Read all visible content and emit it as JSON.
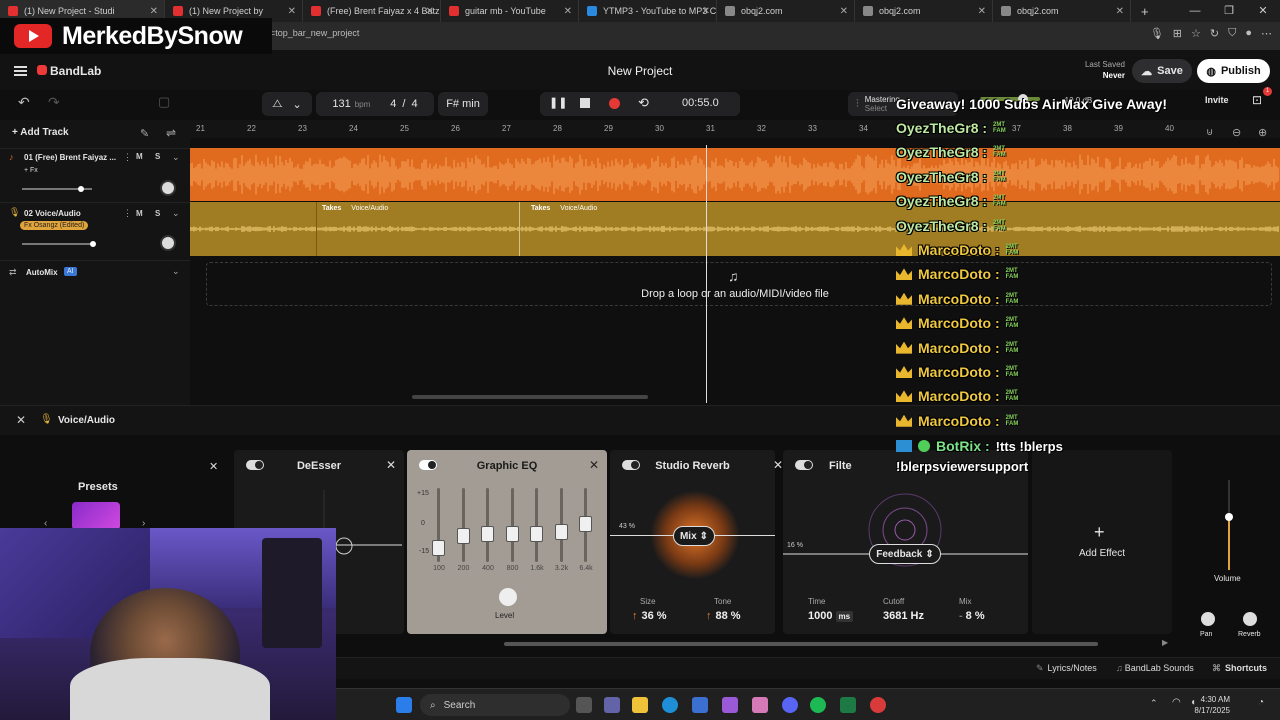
{
  "browser": {
    "tabs": [
      {
        "label": "(1) New Project - Studi",
        "active": true,
        "color": "#e23030"
      },
      {
        "label": "(1) New Project by",
        "active": false,
        "color": "#e23030"
      },
      {
        "label": "(Free) Brent Faiyaz x 4 Batz",
        "active": false,
        "color": "#e23030"
      },
      {
        "label": "guitar mb - YouTube",
        "active": false,
        "color": "#e23030"
      },
      {
        "label": "YTMP3 - YouTube to MP3 C",
        "active": false,
        "color": "#2a8ae0"
      },
      {
        "label": "obqj2.com",
        "active": false,
        "color": "#888888"
      },
      {
        "label": "obqj2.com",
        "active": false,
        "color": "#888888"
      },
      {
        "label": "obqj2.com",
        "active": false,
        "color": "#888888"
      }
    ],
    "address": "n=top_bar_new_project"
  },
  "overlay": {
    "channel_name": "MerkedBySnow"
  },
  "app": {
    "brand": "BandLab",
    "project_title": "New Project",
    "last_saved_label": "Last Saved",
    "last_saved_value": "Never",
    "save_label": "Save",
    "publish_label": "Publish",
    "invite_label": "Invite",
    "mastering_label": "Mastering",
    "mastering_sub": "Select",
    "tempo": "131",
    "tempo_unit": "bpm",
    "time_sig_num": "4",
    "time_sig_den": "4",
    "key": "F# min",
    "time": "00:55.0",
    "master_db": "-10.0 dB"
  },
  "tracks": {
    "add_track_label": "Add Track",
    "ruler": [
      "21",
      "22",
      "23",
      "24",
      "25",
      "26",
      "27",
      "28",
      "29",
      "30",
      "31",
      "32",
      "33",
      "34",
      "35",
      "36",
      "37",
      "38",
      "39",
      "40"
    ],
    "items": [
      {
        "number": "01",
        "name": "(Free) Brent Faiyaz ...",
        "fx": "+ Fx",
        "mute": "M",
        "solo": "S"
      },
      {
        "number": "02",
        "name": "Voice/Audio",
        "fx": "Fx Osangz (Edited)",
        "mute": "M",
        "solo": "S"
      }
    ],
    "automix_label": "AutoMix",
    "automix_badge": "AI",
    "clip_labels": [
      "Takes",
      "Voice/Audio",
      "Takes",
      "Voice/Audio"
    ],
    "drop_text": "Drop a loop or an audio/MIDI/video file"
  },
  "effects": {
    "track_label": "Voice/Audio",
    "presets_label": "Presets",
    "cards": {
      "deesser": {
        "title": "DeEsser"
      },
      "eq": {
        "title": "Graphic EQ",
        "db_labels": [
          "+15",
          "0",
          "-15"
        ],
        "freqs": [
          "100",
          "200",
          "400",
          "800",
          "1.6k",
          "3.2k",
          "6.4k"
        ],
        "level_label": "Level"
      },
      "reverb": {
        "title": "Studio Reverb",
        "mix_pct": "43 %",
        "mix_label": "Mix",
        "size_label": "Size",
        "size_value": "36 %",
        "tone_label": "Tone",
        "tone_value": "88 %"
      },
      "filter": {
        "title": "Filte",
        "pct": "16 %",
        "feedback_label": "Feedback",
        "time_label": "Time",
        "time_value": "1000",
        "time_unit": "ms",
        "cutoff_label": "Cutoff",
        "cutoff_value": "3681 Hz",
        "mix_label": "Mix",
        "mix_value": "8 %"
      }
    },
    "add_effect_label": "Add Effect",
    "volume_label": "Volume",
    "pan_label": "Pan",
    "reverb_label": "Reverb"
  },
  "bottom": {
    "lyrics": "Lyrics/Notes",
    "sounds": "BandLab Sounds",
    "shortcuts": "Shortcuts"
  },
  "taskbar": {
    "search": "Search",
    "time": "4:30 AM",
    "date": "8/17/2025"
  },
  "chat": {
    "header": "Giveaway! 1000 Subs AirMax Give Away!",
    "badge_text": "2MT FAM",
    "lines": [
      {
        "user": "OyezTheGr8 :"
      },
      {
        "user": "OyezTheGr8 :"
      },
      {
        "user": "OyezTheGr8 :"
      },
      {
        "user": "OyezTheGr8 :"
      },
      {
        "user": "OyezTheGr8 :"
      },
      {
        "user": "MarcoDoto :"
      },
      {
        "user": "MarcoDoto :"
      },
      {
        "user": "MarcoDoto :"
      },
      {
        "user": "MarcoDoto :"
      },
      {
        "user": "MarcoDoto :"
      },
      {
        "user": "MarcoDoto :"
      },
      {
        "user": "MarcoDoto :"
      },
      {
        "user": "MarcoDoto :"
      }
    ],
    "bot_user": "BotRix :",
    "bot_msg": "!tts !blerps",
    "bot_msg2": "!blerpsviewersupport"
  },
  "colors": {
    "orange_track": "#e06a1e",
    "gold_track": "#a07c22",
    "record": "#e53935",
    "accent": "#f03a3a"
  }
}
